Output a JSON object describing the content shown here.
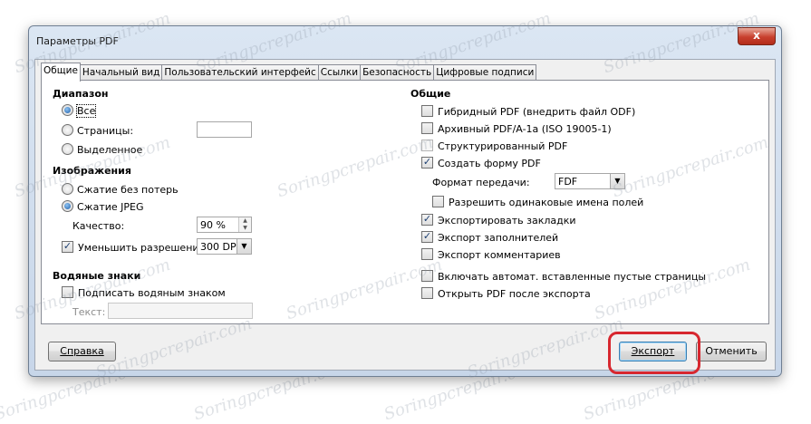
{
  "window": {
    "title": "Параметры PDF",
    "close_glyph": "x"
  },
  "tabs": [
    {
      "label": "Общие"
    },
    {
      "label": "Начальный вид"
    },
    {
      "label": "Пользовательский интерфейс"
    },
    {
      "label": "Ссылки"
    },
    {
      "label": "Безопасность"
    },
    {
      "label": "Цифровые подписи"
    }
  ],
  "range": {
    "heading": "Диапазон",
    "all": {
      "label": "Все",
      "selected": true
    },
    "pages": {
      "label": "Страницы:",
      "selected": false,
      "value": ""
    },
    "selection": {
      "label": "Выделенное",
      "selected": false
    }
  },
  "images": {
    "heading": "Изображения",
    "lossless": {
      "label": "Сжатие без потерь",
      "selected": false
    },
    "jpeg": {
      "label": "Сжатие JPEG",
      "selected": true
    },
    "quality": {
      "label": "Качество:",
      "value": "90 %"
    },
    "reduce": {
      "label": "Уменьшить разрешение",
      "checked": true,
      "value": "300 DPI"
    }
  },
  "watermark": {
    "heading": "Водяные знаки",
    "sign": {
      "label": "Подписать водяным знаком",
      "checked": false
    },
    "text": {
      "label": "Текст:",
      "value": ""
    }
  },
  "general": {
    "heading": "Общие",
    "hybrid": {
      "label": "Гибридный PDF (внедрить файл ODF)",
      "checked": false
    },
    "archive": {
      "label": "Архивный PDF/A-1a (ISO 19005-1)",
      "checked": false
    },
    "tagged": {
      "label": "Структурированный PDF",
      "checked": false
    },
    "form": {
      "label": "Создать форму PDF",
      "checked": true
    },
    "format": {
      "label": "Формат передачи:",
      "value": "FDF"
    },
    "dup_names": {
      "label": "Разрешить одинаковые имена полей",
      "checked": false
    },
    "bookmarks": {
      "label": "Экспортировать закладки",
      "checked": true
    },
    "placeholders": {
      "label": "Экспорт заполнителей",
      "checked": true
    },
    "comments": {
      "label": "Экспорт комментариев",
      "checked": false
    },
    "blank_pages": {
      "label": "Включать автомат. вставленные пустые страницы",
      "checked": false
    },
    "open_after": {
      "label": "Открыть PDF после экспорта",
      "checked": false
    }
  },
  "buttons": {
    "help": "Справка",
    "export": "Экспорт",
    "cancel": "Отменить"
  },
  "watermark_overlay": {
    "text": "Soringpcrepair.com"
  },
  "colors": {
    "highlight": "#d7272f",
    "radio_selected": "#1f5fa8"
  }
}
